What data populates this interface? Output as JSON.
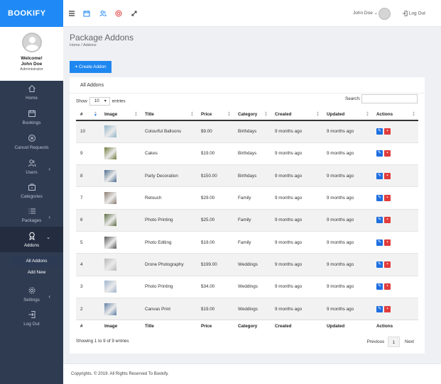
{
  "brand": "BOOKIFY",
  "profile": {
    "welcome": "Welcome!",
    "name": "John Doe",
    "role": "Administrator"
  },
  "nav": [
    {
      "label": "Home",
      "icon": "home-icon"
    },
    {
      "label": "Bookings",
      "icon": "calendar-icon"
    },
    {
      "label": "Cancel Requests",
      "icon": "cancel-icon"
    },
    {
      "label": "Users",
      "icon": "users-icon"
    },
    {
      "label": "Categories",
      "icon": "briefcase-icon"
    },
    {
      "label": "Packages",
      "icon": "list-icon"
    },
    {
      "label": "Addons",
      "icon": "award-icon"
    },
    {
      "label": "Settings",
      "icon": "gear-icon"
    },
    {
      "label": "Log Out",
      "icon": "logout-icon"
    }
  ],
  "addons_sub": [
    "All Addons",
    "Add New"
  ],
  "topbar": {
    "user": "John Doe",
    "logout": "Log Out"
  },
  "page": {
    "title": "Package Addons",
    "breadcrumb": "Home  /  Addons",
    "create_button": "Create Addon"
  },
  "card": {
    "title": "All Addons",
    "show_label": "Show",
    "entries_value": "10",
    "entries_label": "entries",
    "search_label": "Search:",
    "search_placeholder": ""
  },
  "table": {
    "columns": [
      "#",
      "Image",
      "Title",
      "Price",
      "Category",
      "Created",
      "Updated",
      "Actions"
    ],
    "rows": [
      {
        "id": "10",
        "title": "Colourful Balloons",
        "price": "$9.00",
        "category": "Birthdays",
        "created": "9 months ago",
        "updated": "9 months ago",
        "color": "#8fb3c9"
      },
      {
        "id": "9",
        "title": "Cakes",
        "price": "$19.00",
        "category": "Birthdays",
        "created": "9 months ago",
        "updated": "9 months ago",
        "color": "#6e7a3a"
      },
      {
        "id": "8",
        "title": "Party Decoration",
        "price": "$150.00",
        "category": "Birthdays",
        "created": "9 months ago",
        "updated": "9 months ago",
        "color": "#4a6a8c"
      },
      {
        "id": "7",
        "title": "Retouch",
        "price": "$29.00",
        "category": "Family",
        "created": "9 months ago",
        "updated": "9 months ago",
        "color": "#8a7a6e"
      },
      {
        "id": "6",
        "title": "Photo Printing",
        "price": "$25.00",
        "category": "Family",
        "created": "9 months ago",
        "updated": "9 months ago",
        "color": "#5a6b3f"
      },
      {
        "id": "5",
        "title": "Photo Editing",
        "price": "$19.00",
        "category": "Family",
        "created": "9 months ago",
        "updated": "9 months ago",
        "color": "#555555"
      },
      {
        "id": "4",
        "title": "Drone Photography",
        "price": "$199.00",
        "category": "Weddings",
        "created": "9 months ago",
        "updated": "9 months ago",
        "color": "#b8b8b8"
      },
      {
        "id": "3",
        "title": "Photo Printing",
        "price": "$34.00",
        "category": "Weddings",
        "created": "9 months ago",
        "updated": "9 months ago",
        "color": "#9fb4cf"
      },
      {
        "id": "2",
        "title": "Canvas Print",
        "price": "$19.00",
        "category": "Weddings",
        "created": "9 months ago",
        "updated": "9 months ago",
        "color": "#5f7ea6"
      }
    ]
  },
  "info": "Showing 1 to 9 of 9 entries",
  "pagination": {
    "previous": "Previous",
    "page": "1",
    "next": "Next"
  },
  "footer": "Copyrights. © 2019. All Rights Reserved To Bookify.",
  "colors": {
    "primary": "#1e87f0",
    "sidebar": "#2f3b51",
    "danger": "#e03c3c"
  }
}
